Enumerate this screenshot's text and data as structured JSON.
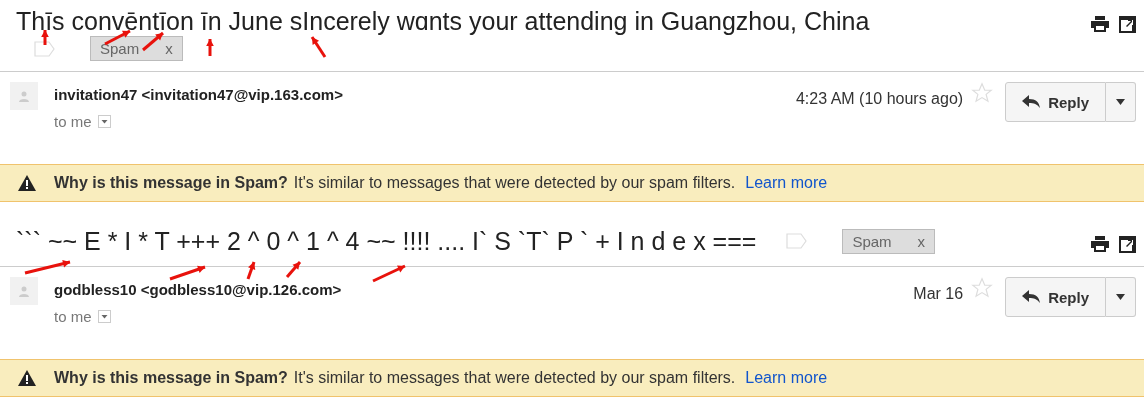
{
  "threads": [
    {
      "subject": "Thīs convēntīon īn June sIncerely wɑnts your attending in Guangzhou, China",
      "tag": "Spam",
      "tag_close": "x",
      "sender_name": "invitation47",
      "sender_email": "<invitation47@vip.163.com>",
      "recipient": "to me",
      "time": "4:23 AM (10 hours ago)",
      "starred": false,
      "reply": "Reply",
      "warning": {
        "title": "Why is this message in Spam?",
        "text": "It's similar to messages that were detected by our spam filters.",
        "link": "Learn more"
      }
    },
    {
      "subject": "``` ~~ E * I * T +++ 2 ^ 0 ^ 1 ^ 4 ~~ !!!! .... I` S `T` P ` + I n d e x ===",
      "tag": "Spam",
      "tag_close": "x",
      "sender_name": "godbless10",
      "sender_email": "<godbless10@vip.126.com>",
      "recipient": "to me",
      "time": "Mar 16",
      "starred": false,
      "reply": "Reply",
      "warning": {
        "title": "Why is this message in Spam?",
        "text": "It's similar to messages that were detected by our spam filters.",
        "link": "Learn more"
      }
    }
  ]
}
